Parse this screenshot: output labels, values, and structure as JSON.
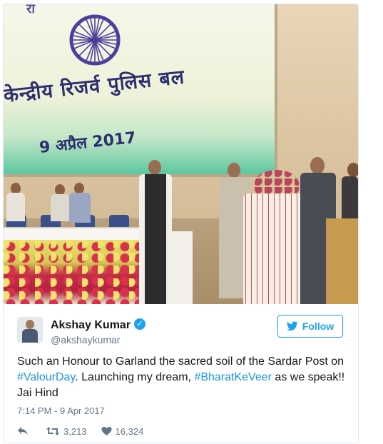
{
  "photo": {
    "screen_top_text": "रा",
    "screen_line_1": "केन्द्रीय रिजर्व पुलिस बल",
    "screen_line_2": "9 अप्रैल 2017",
    "chakra_icon": "ashoka-chakra"
  },
  "tweet": {
    "author_name": "Akshay Kumar",
    "author_handle": "@akshaykumar",
    "verified_icon": "verified-badge-icon",
    "follow_label": "Follow",
    "text_parts": [
      {
        "text": "Such an Honour to Garland the sacred soil of the Sardar Post on ",
        "tag": false
      },
      {
        "text": "#ValourDay",
        "tag": true
      },
      {
        "text": ". Launching my dream, ",
        "tag": false
      },
      {
        "text": "#BharatKeVeer",
        "tag": true
      },
      {
        "text": " as we speak!! Jai Hind",
        "tag": false
      }
    ],
    "timestamp": "7:14 PM - 9 Apr 2017",
    "retweet_count": "3,213",
    "like_count": "16,324"
  },
  "colors": {
    "accent": "#1da1f2",
    "hashtag": "#1b95e0",
    "muted": "#657786",
    "text": "#14171a"
  }
}
